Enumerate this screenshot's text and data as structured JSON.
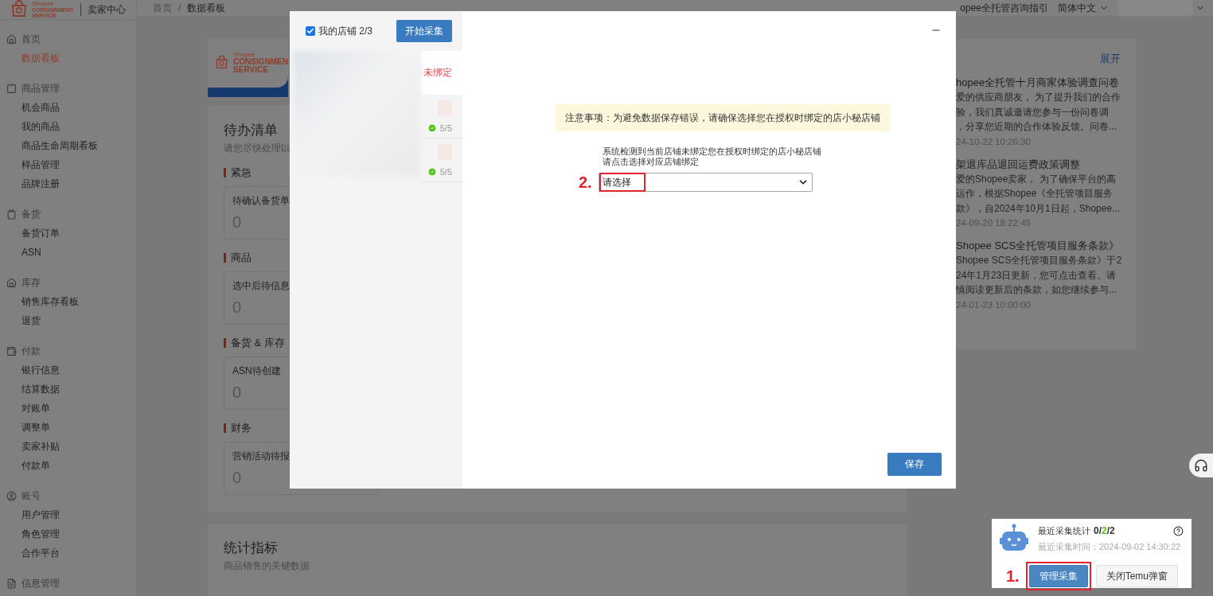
{
  "sidebar": {
    "logo": {
      "brand": "Shopee",
      "line1": "CONSIGNMENT",
      "line2": "SERVICE"
    },
    "title": "卖家中心",
    "sections": [
      {
        "label": "首页",
        "items": [
          {
            "label": "数据看板",
            "selected": true
          }
        ]
      },
      {
        "label": "商品管理",
        "items": [
          {
            "label": "机会商品",
            "selected": false
          },
          {
            "label": "我的商品",
            "selected": false
          },
          {
            "label": "商品生命周期看板",
            "selected": false
          },
          {
            "label": "样品管理",
            "selected": false
          },
          {
            "label": "品牌注册",
            "selected": false
          }
        ]
      },
      {
        "label": "备货",
        "items": [
          {
            "label": "备货订单",
            "selected": false
          },
          {
            "label": "ASN",
            "selected": false
          }
        ]
      },
      {
        "label": "库存",
        "items": [
          {
            "label": "销售库存看板",
            "selected": false
          },
          {
            "label": "退货",
            "selected": false
          }
        ]
      },
      {
        "label": "付款",
        "items": [
          {
            "label": "银行信息",
            "selected": false
          },
          {
            "label": "结算数据",
            "selected": false
          },
          {
            "label": "对账单",
            "selected": false
          },
          {
            "label": "调整单",
            "selected": false
          },
          {
            "label": "卖家补贴",
            "selected": false
          },
          {
            "label": "付款单",
            "selected": false
          }
        ]
      },
      {
        "label": "账号",
        "items": [
          {
            "label": "用户管理",
            "selected": false
          },
          {
            "label": "角色管理",
            "selected": false
          },
          {
            "label": "合作平台",
            "selected": false
          }
        ]
      },
      {
        "label": "信息管理"
      }
    ]
  },
  "topbar": {
    "breadcrumb": [
      "首页",
      "数据看板"
    ],
    "separator": "/",
    "help_link": "opee全托管咨询指引",
    "language": "简体中文"
  },
  "banner": {
    "brand": "Shopee",
    "line1": "CONSIGNMEN",
    "line2": "SERVICE"
  },
  "todo": {
    "title": "待办清单",
    "subtitle": "请您尽快处理以",
    "sections": [
      {
        "label": "紧急",
        "tiles": [
          {
            "label": "待确认备货单",
            "value": "0"
          }
        ]
      },
      {
        "label": "商品",
        "tiles": [
          {
            "label": "选中后待信息",
            "value": "0"
          }
        ]
      },
      {
        "label": "备货 & 库存",
        "tiles": [
          {
            "label": "ASN待创建",
            "value": "0"
          }
        ]
      },
      {
        "label": "财务",
        "tiles": [
          {
            "label": "营销活动待报",
            "value": "0"
          }
        ]
      }
    ]
  },
  "stats": {
    "title": "统计指标",
    "subtitle": "商品销售的关键数据"
  },
  "news": {
    "expand": "展开",
    "items": [
      {
        "title": "hopee全托管十月商家体验调查问卷",
        "lines": [
          "爱的供应商朋友， 为了提升我们的合作",
          "验，我们真诚邀请您参与一份问卷调",
          "，分享您近期的合作体验反馈。问卷..."
        ],
        "date": "24-10-22 10:26:30"
      },
      {
        "title": "架退库品退回运费政策调整",
        "lines": [
          "爱的Shopee卖家， 为了确保平台的高",
          "运作，根据Shopee《全托管项目服务",
          "款》，自2024年10月1日起，Shopee..."
        ],
        "date": "24-09-20 18:22:45"
      },
      {
        "title": "Shopee SCS全托管项目服务条款》",
        "lines": [
          "Shopee SCS全托管项目服务条款》于2",
          "24年1月23日更新，您可点击查看。请",
          "慎阅读更新后的条款，如您继续参与..."
        ],
        "date": "24-01-23 10:00:00"
      }
    ]
  },
  "modal": {
    "shops_label": "我的店铺 2/3",
    "all_checked": true,
    "start_button": "开始采集",
    "shops": [
      {
        "kind": "unbound",
        "status": "未绑定",
        "selected": true
      },
      {
        "kind": "done",
        "status": "5/5",
        "selected": false
      },
      {
        "kind": "done",
        "status": "5/5",
        "selected": false
      }
    ],
    "notice": "注意事项：为避免数据保存错误，请确保选择您在授权时绑定的店小秘店铺",
    "message_lines": [
      "系统检测到当前店铺未绑定您在授权时绑定的店小秘店铺",
      "请点击选择对应店铺绑定"
    ],
    "step_mark": "2.",
    "select_value": "请选择",
    "save_button": "保存"
  },
  "widget": {
    "stats_label": "最近采集统计",
    "stats_parts": [
      {
        "text": "0/",
        "color": "#333333"
      },
      {
        "text": "2",
        "color": "#52c41a"
      },
      {
        "text": "/2",
        "color": "#333333"
      }
    ],
    "time_label": "最近采集时间：2024-09-02 14:30:22",
    "step_mark": "1.",
    "manage_button": "管理采集",
    "close_button": "关闭Temu弹窗"
  }
}
